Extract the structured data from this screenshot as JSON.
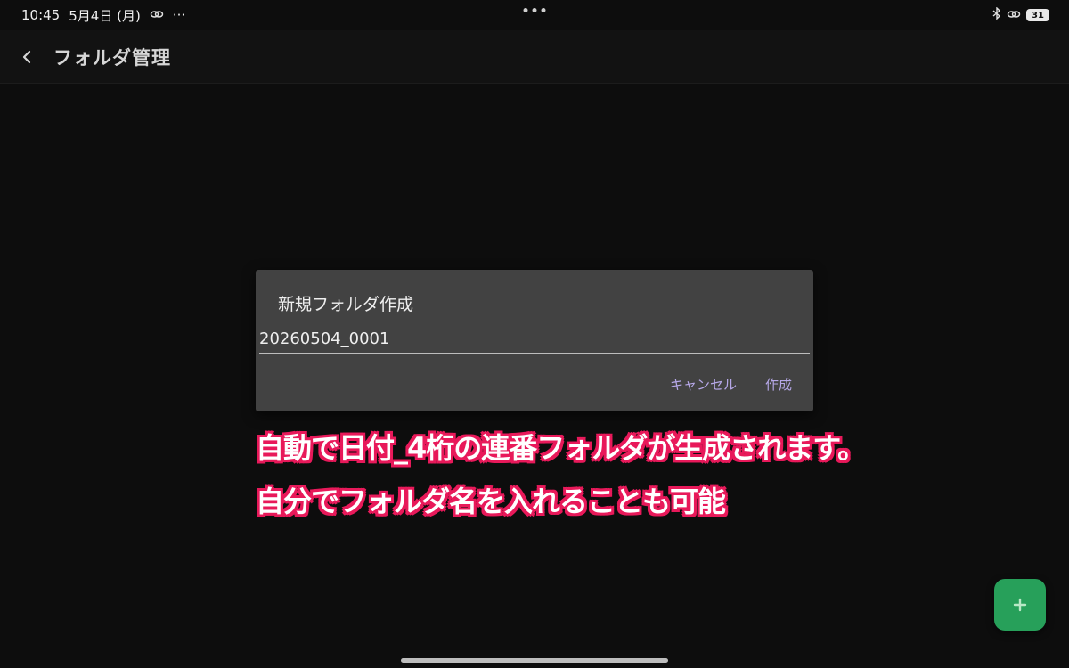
{
  "status_bar": {
    "time": "10:45",
    "date": "5月4日 (月)",
    "ellipsis": "···",
    "battery_level": "31"
  },
  "app_bar": {
    "title": "フォルダ管理"
  },
  "dialog": {
    "title": "新規フォルダ作成",
    "input_value": "20260504_0001",
    "cancel_label": "キャンセル",
    "create_label": "作成"
  },
  "captions": {
    "line1": "自動で日付_4桁の連番フォルダが生成されます。",
    "line2": "自分でフォルダ名を入れることも可能"
  },
  "fab": {
    "label": "+"
  },
  "colors": {
    "background": "#0d0d0d",
    "dialog": "#424242",
    "accent_button": "#b6a8e8",
    "fab": "#27a05a",
    "caption_outline": "#e8195a"
  }
}
